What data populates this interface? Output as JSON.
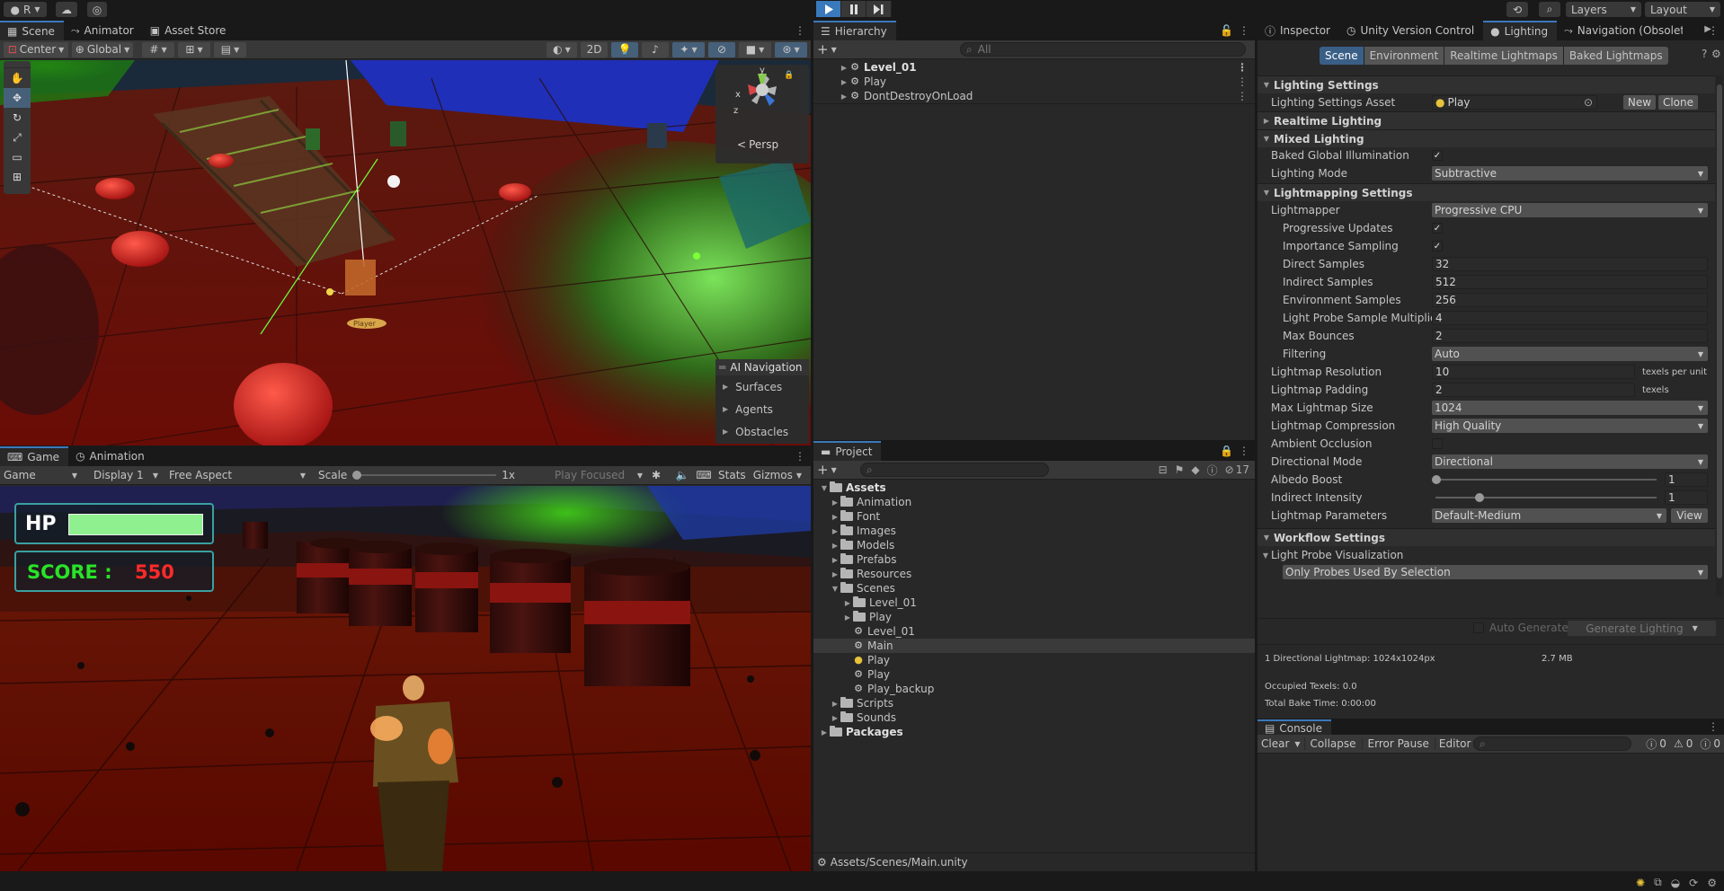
{
  "topbar": {
    "account_label": "R",
    "layers_label": "Layers",
    "layout_label": "Layout",
    "play_icon": "play-icon",
    "pause_icon": "pause-icon",
    "step_icon": "step-icon"
  },
  "scene_panel": {
    "tabs": [
      "Scene",
      "Animator",
      "Asset Store"
    ],
    "pivot_label": "Center",
    "space_label": "Global",
    "mode_2d": "2D",
    "persp_label": "Persp",
    "gizmo_axes": {
      "y": "y",
      "x": "x",
      "z": "z"
    },
    "ai_nav": {
      "title": "AI Navigation",
      "items": [
        "Surfaces",
        "Agents",
        "Obstacles"
      ]
    },
    "player_tag": "Player"
  },
  "game_panel": {
    "tabs": [
      "Game",
      "Animation"
    ],
    "game_dropdown": "Game",
    "display": "Display 1",
    "aspect": "Free Aspect",
    "scale_label": "Scale",
    "scale_value": "1x",
    "play_focused": "Play Focused",
    "stats": "Stats",
    "gizmos": "Gizmos",
    "hud": {
      "hp_label": "HP",
      "hp_fill": 1.0,
      "score_label": "SCORE :",
      "score_value": "550"
    }
  },
  "hierarchy": {
    "title": "Hierarchy",
    "search_placeholder": "All",
    "items": [
      "Level_01",
      "Play",
      "DontDestroyOnLoad"
    ]
  },
  "project": {
    "title": "Project",
    "badge_count": "17",
    "root": "Assets",
    "folders": [
      "Animation",
      "Font",
      "Images",
      "Models",
      "Prefabs",
      "Resources",
      "Scenes"
    ],
    "scene_children": [
      "Level_01",
      "Play",
      "Level_01",
      "Main",
      "Play",
      "Play",
      "Play_backup"
    ],
    "after_scenes": [
      "Scripts",
      "Sounds"
    ],
    "packages": "Packages",
    "status_path": "Assets/Scenes/Main.unity"
  },
  "inspector": {
    "tabs": [
      "Inspector",
      "Unity Version Control",
      "Lighting",
      "Navigation (Obsolete"
    ],
    "subtabs": [
      "Scene",
      "Environment",
      "Realtime Lightmaps",
      "Baked Lightmaps"
    ],
    "lighting_settings": {
      "header": "Lighting Settings",
      "asset_label": "Lighting Settings Asset",
      "asset_value": "Play",
      "new_button": "New",
      "clone_button": "Clone"
    },
    "realtime_header": "Realtime Lighting",
    "mixed": {
      "header": "Mixed Lighting",
      "baked_gi_label": "Baked Global Illumination",
      "baked_gi": true,
      "mode_label": "Lighting Mode",
      "mode_value": "Subtractive"
    },
    "lightmapping": {
      "header": "Lightmapping Settings",
      "lightmapper_label": "Lightmapper",
      "lightmapper_value": "Progressive CPU",
      "progressive_updates_label": "Progressive Updates",
      "importance_sampling_label": "Importance Sampling",
      "direct_samples_label": "Direct Samples",
      "direct_samples": "32",
      "indirect_samples_label": "Indirect Samples",
      "indirect_samples": "512",
      "env_samples_label": "Environment Samples",
      "env_samples": "256",
      "probe_mult_label": "Light Probe Sample Multiplie",
      "probe_mult": "4",
      "max_bounces_label": "Max Bounces",
      "max_bounces": "2",
      "filtering_label": "Filtering",
      "filtering_value": "Auto",
      "resolution_label": "Lightmap Resolution",
      "resolution": "10",
      "resolution_unit": "texels per unit",
      "padding_label": "Lightmap Padding",
      "padding": "2",
      "padding_unit": "texels",
      "max_size_label": "Max Lightmap Size",
      "max_size": "1024",
      "compression_label": "Lightmap Compression",
      "compression": "High Quality",
      "ao_label": "Ambient Occlusion",
      "directional_label": "Directional Mode",
      "directional": "Directional",
      "albedo_label": "Albedo Boost",
      "albedo_value": "1",
      "indirect_label": "Indirect Intensity",
      "indirect_value": "1",
      "params_label": "Lightmap Parameters",
      "params_value": "Default-Medium",
      "view_button": "View"
    },
    "workflow": {
      "header": "Workflow Settings",
      "probe_vis_label": "Light Probe Visualization",
      "probe_vis_value": "Only Probes Used By Selection"
    },
    "auto_generate": "Auto Generate",
    "generate_button": "Generate Lighting",
    "stats": {
      "lightmap_info": "1 Directional Lightmap: 1024x1024px",
      "size": "2.7 MB",
      "occupied": "Occupied Texels: 0.0",
      "bake_time": "Total Bake Time: 0:00:00"
    }
  },
  "console": {
    "title": "Console",
    "clear": "Clear",
    "collapse": "Collapse",
    "error_pause": "Error Pause",
    "editor": "Editor",
    "counts": [
      "0",
      "0",
      "0"
    ]
  },
  "colors": {
    "accent": "#3a79bb",
    "panel_bg": "#282828",
    "hud_green": "#8ef08e",
    "score_green": "#29e329",
    "score_red": "#ff2a2a"
  }
}
